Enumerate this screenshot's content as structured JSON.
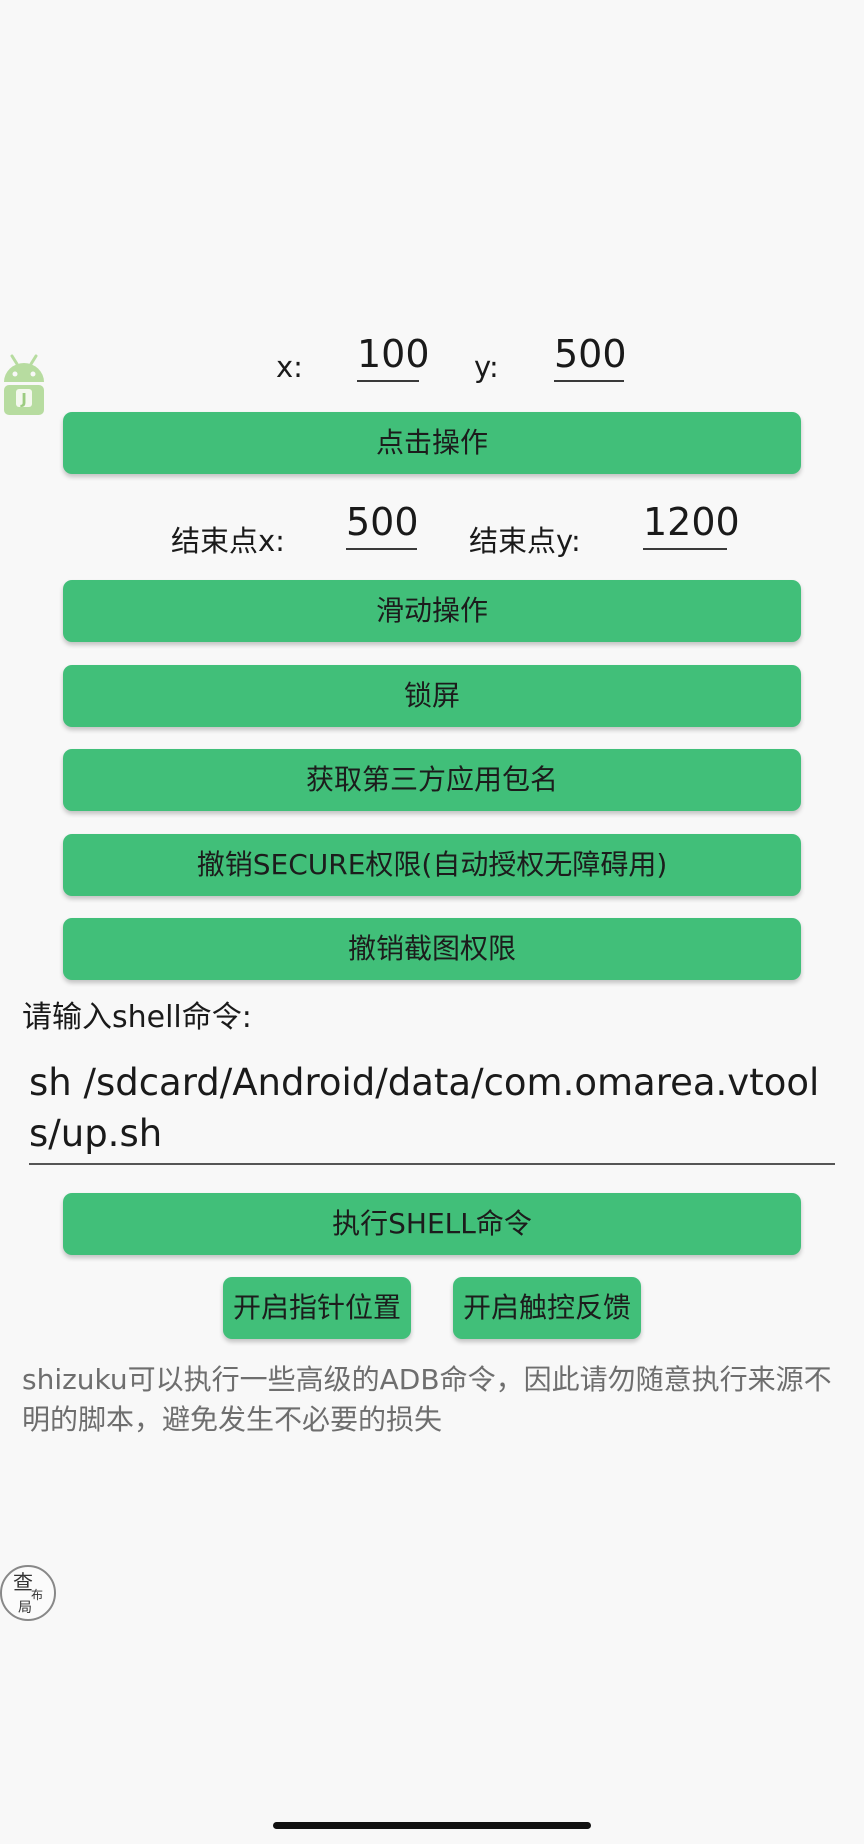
{
  "tap": {
    "x_label": "x:",
    "x_value": "100",
    "y_label": "y:",
    "y_value": "500",
    "button": "点击操作"
  },
  "swipe": {
    "end_x_label": "结束点x:",
    "end_x_value": "500",
    "end_y_label": "结束点y:",
    "end_y_value": "1200",
    "button": "滑动操作"
  },
  "buttons": {
    "lock_screen": "锁屏",
    "get_packages": "获取第三方应用包名",
    "revoke_secure": "撤销SECURE权限(自动授权无障碍用)",
    "revoke_screenshot": "撤销截图权限"
  },
  "shell": {
    "label": "请输入shell命令:",
    "value": "sh /sdcard/Android/data/com.omarea.vtools/up.sh",
    "execute_button": "执行SHELL命令"
  },
  "toggles": {
    "pointer_location": "开启指针位置",
    "touch_feedback": "开启触控反馈"
  },
  "notice": "shizuku可以执行一些高级的ADB命令，因此请勿随意执行来源不明的脚本，避免发生不必要的损失",
  "floating": {
    "android_icon": "android-icon",
    "stamp": {
      "char_top": "查",
      "char_middle": "布",
      "char_bottom": "局"
    }
  },
  "colors": {
    "button_green": "#41bf79",
    "background": "#f8f8f8",
    "notice_text": "#6e6e6e"
  }
}
